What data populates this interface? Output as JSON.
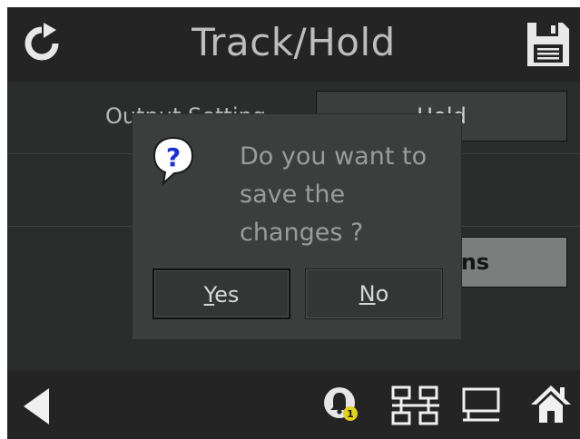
{
  "header": {
    "title": "Track/Hold",
    "left_icon": "refresh-icon",
    "right_icon": "save-icon"
  },
  "rows": [
    {
      "label": "Output Setting",
      "value": "Hold"
    },
    {
      "label": "",
      "value": "Options"
    }
  ],
  "dialog": {
    "icon": "question-icon",
    "message_lines": [
      "Do you want to",
      "save the",
      "changes ?"
    ],
    "yes_accel": "Y",
    "yes_rest": "es",
    "no_accel": "N",
    "no_rest": "o"
  },
  "footer": {
    "icons": [
      "back-icon",
      "alarm-bell-icon",
      "network-icon",
      "monitor-icon",
      "home-icon"
    ],
    "alarm_badge": "1"
  },
  "colors": {
    "background": "#141514",
    "bars": "#232423",
    "panel": "#2b2d2c",
    "dialog": "#3c3e3d",
    "badge": "#e3d21c"
  }
}
